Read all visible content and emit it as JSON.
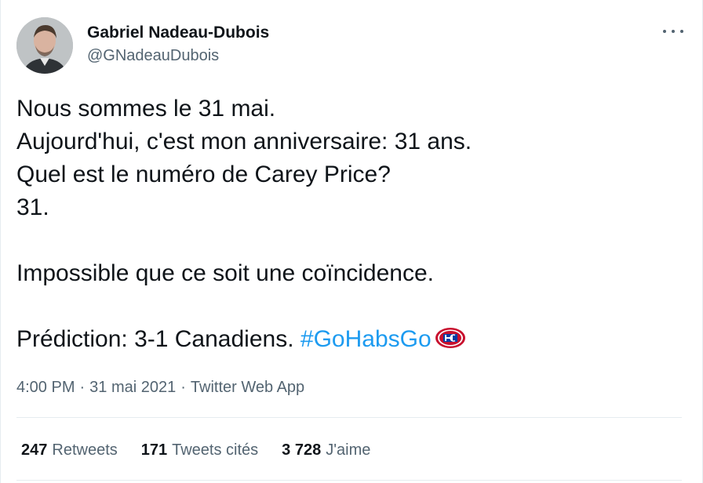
{
  "author": {
    "display_name": "Gabriel Nadeau-Dubois",
    "handle": "@GNadeauDubois"
  },
  "tweet": {
    "lines": [
      "Nous sommes le 31 mai.",
      "Aujourd'hui, c'est mon anniversaire: 31 ans.",
      "Quel est le numéro de Carey Price?",
      "31.",
      "Impossible que ce soit une coïncidence.",
      "Prédiction: 3-1 Canadiens."
    ],
    "hashtag": "#GoHabsGo",
    "emoji_icon": "canadiens-logo-icon"
  },
  "meta": {
    "time": "4:00 PM",
    "separator": "·",
    "date": "31 mai 2021",
    "source": "Twitter Web App"
  },
  "stats": {
    "retweets_count": "247",
    "retweets_label": "Retweets",
    "quotes_count": "171",
    "quotes_label": "Tweets cités",
    "likes_count": "3 728",
    "likes_label": "J'aime"
  },
  "colors": {
    "text": "#0f1419",
    "secondary": "#536471",
    "link": "#1d9bf0",
    "border": "#e6ecf0",
    "habs_red": "#c8102e",
    "habs_blue": "#003da5"
  }
}
